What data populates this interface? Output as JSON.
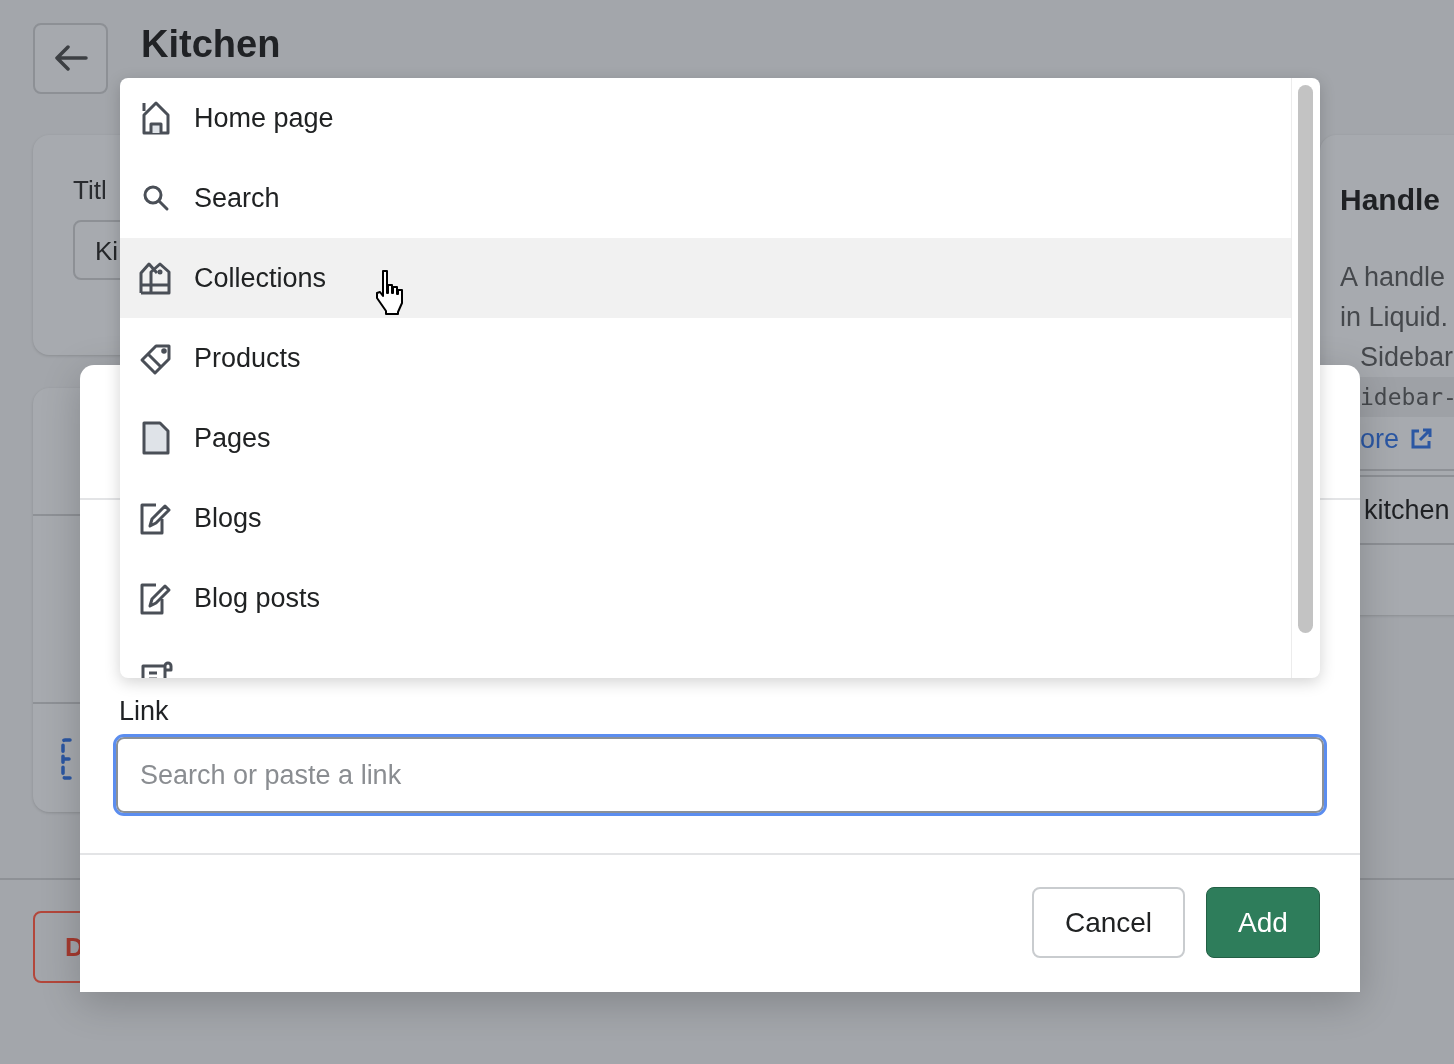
{
  "header": {
    "title": "Kitchen"
  },
  "title_card": {
    "label": "Titl",
    "value": "Ki"
  },
  "handle_card": {
    "heading": "Handle",
    "lines": [
      "A handle",
      "in Liquid.",
      "Sidebar"
    ],
    "code": "idebar-",
    "link": "ore",
    "value": "kitchen"
  },
  "delete_button": "D",
  "dialog": {
    "link_label": "Link",
    "link_placeholder": "Search or paste a link",
    "buttons": [
      {
        "label": "Cancel",
        "kind": "secondary"
      },
      {
        "label": "Add",
        "kind": "primary"
      }
    ]
  },
  "link_menu": {
    "items": [
      {
        "label": "Home page",
        "kind": "house",
        "selected": false
      },
      {
        "label": "Search",
        "kind": "search",
        "selected": false
      },
      {
        "label": "Collections",
        "kind": "collections",
        "selected": true
      },
      {
        "label": "Products",
        "kind": "tag",
        "selected": false
      },
      {
        "label": "Pages",
        "kind": "page",
        "selected": false
      },
      {
        "label": "Blogs",
        "kind": "edit",
        "selected": false
      },
      {
        "label": "Blog posts",
        "kind": "edit",
        "selected": false
      },
      {
        "kind": "policies",
        "selected": false
      }
    ]
  }
}
